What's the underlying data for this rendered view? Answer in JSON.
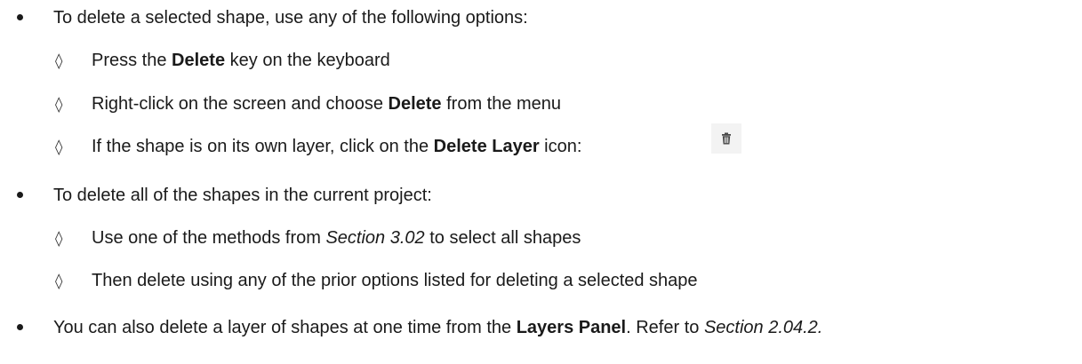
{
  "list": {
    "item1": {
      "text": "To delete a selected shape, use any of the following options:",
      "sub": [
        {
          "pre": "Press the ",
          "bold": "Delete",
          "post": " key on the keyboard"
        },
        {
          "pre": "Right-click on the screen and choose ",
          "bold": "Delete",
          "post": " from the menu"
        },
        {
          "pre": "If the shape is on its own layer, click on the ",
          "bold": "Delete Layer",
          "post": " icon:"
        }
      ]
    },
    "item2": {
      "text": "To delete all of the shapes in the current project:",
      "sub": [
        {
          "pre": "Use one of the methods from ",
          "italic": "Section 3.02",
          "post": " to select all shapes"
        },
        {
          "text": "Then delete using any of the prior options listed for deleting a selected shape"
        }
      ]
    },
    "item3": {
      "pre": "You can also delete a layer of shapes at one time from the ",
      "bold": "Layers Panel",
      "mid": ". Refer to ",
      "italic": "Section 2.04.2."
    }
  },
  "icons": {
    "bullet": "solid-circle-bullet",
    "sub_bullet": "diamond-outline-bullet",
    "delete_layer": "trash-can-icon"
  },
  "sub_bullet_glyph": "◊"
}
